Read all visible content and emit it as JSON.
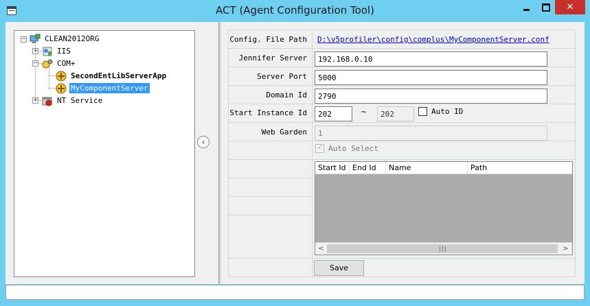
{
  "window": {
    "title": "ACT (Agent Configuration Tool)"
  },
  "tree": {
    "root": "CLEAN2012ORG",
    "iis": "IIS",
    "complus": "COM+",
    "app1": "SecondEntLibServerApp",
    "app2": "MyComponentServer",
    "nt_service": "NT Service"
  },
  "config": {
    "config_file_path_label": "Config. File Path",
    "config_file_path_value": "D:\\v5profiler\\config\\complus\\MyComponentServer.conf",
    "jennifer_server_label": "Jennifer Server",
    "jennifer_server_value": "192.168.0.10",
    "server_port_label": "Server Port",
    "server_port_value": "5000",
    "domain_id_label": "Domain Id",
    "domain_id_value": "2790",
    "start_instance_label": "Start Instance Id",
    "start_instance_from": "202",
    "tilde": "~",
    "start_instance_to": "202",
    "auto_id_label": "Auto ID",
    "web_garden_label": "Web Garden",
    "web_garden_value": "1",
    "auto_select_label": "Auto Select",
    "grid_columns": [
      "Start Id",
      "End Id",
      "Name",
      "Path"
    ],
    "scroll_left": "<",
    "scroll_right": ">",
    "scroll_thumb": "|||",
    "save_label": "Save"
  },
  "icons": {
    "collapse": "‹",
    "expander_minus": "−",
    "expander_plus": "+"
  }
}
